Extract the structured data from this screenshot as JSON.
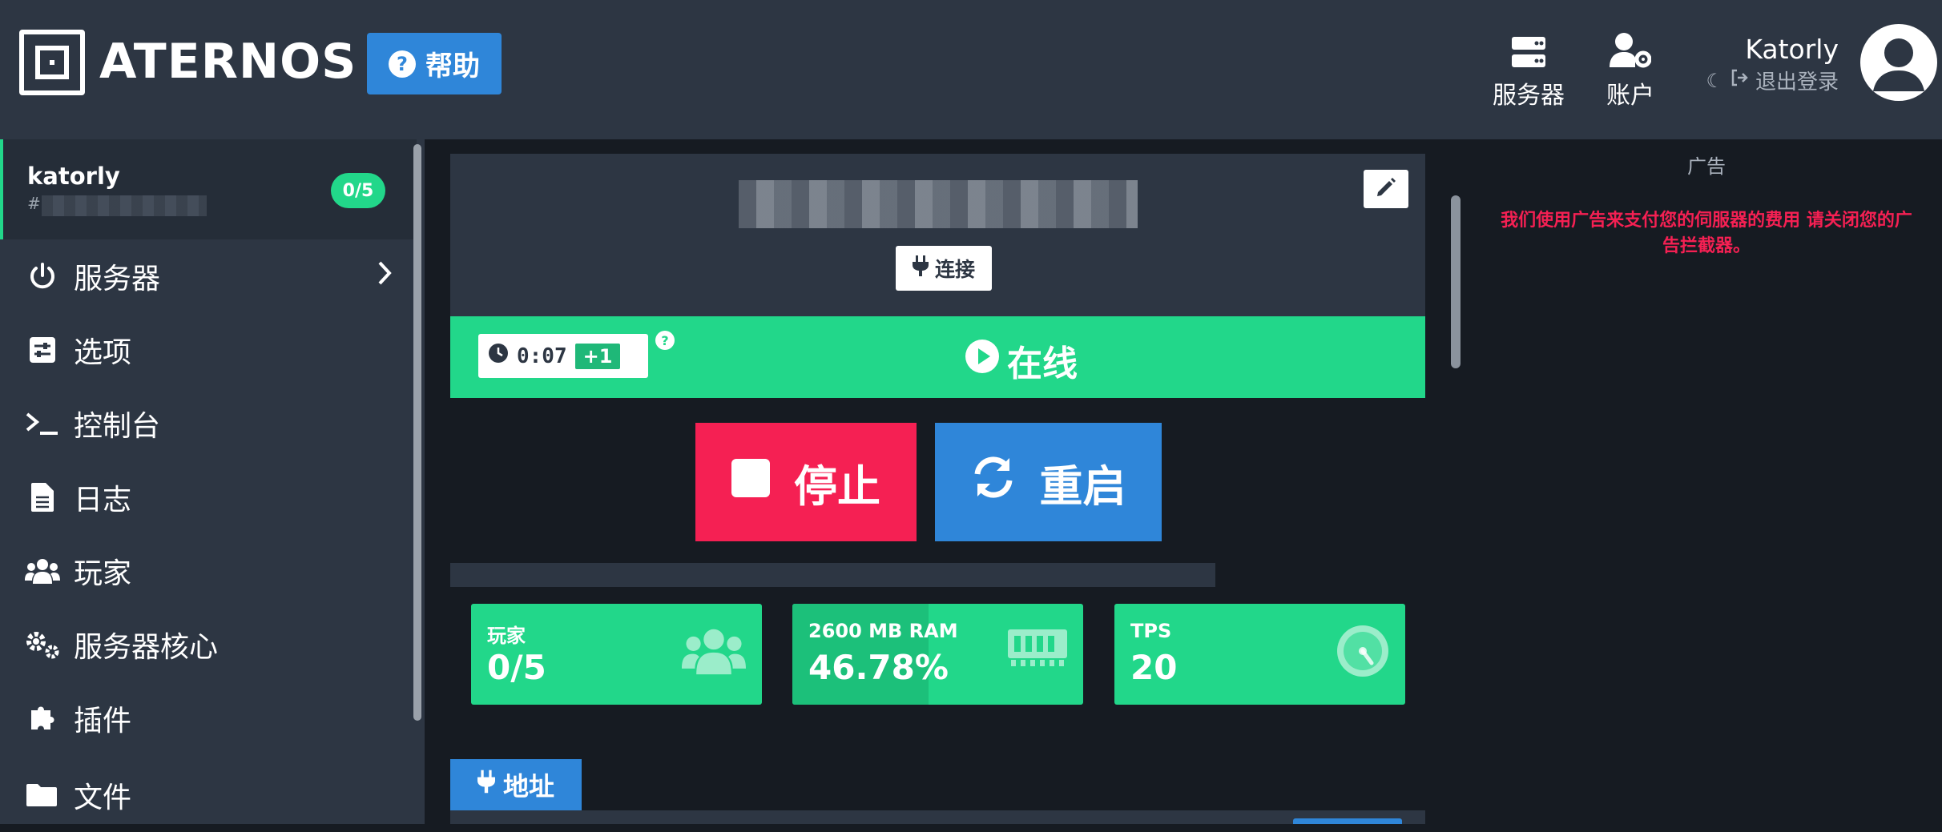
{
  "header": {
    "logo_text": "ATERNOS",
    "help_label": "帮助",
    "help_icon_glyph": "?",
    "nav": [
      {
        "label": "服务器",
        "icon": "server-icon"
      },
      {
        "label": "账户",
        "icon": "user-gear-icon"
      }
    ],
    "user_name": "Katorly",
    "logout_label": "退出登录"
  },
  "sidebar": {
    "server": {
      "name": "katorly",
      "id_prefix": "#",
      "players_badge": "0/5"
    },
    "items": [
      {
        "label": "服务器",
        "icon": "power-icon"
      },
      {
        "label": "选项",
        "icon": "sliders-icon"
      },
      {
        "label": "控制台",
        "icon": "terminal-icon"
      },
      {
        "label": "日志",
        "icon": "file-icon"
      },
      {
        "label": "玩家",
        "icon": "users-icon"
      },
      {
        "label": "服务器核心",
        "icon": "cogs-icon"
      },
      {
        "label": "插件",
        "icon": "puzzle-icon"
      },
      {
        "label": "文件",
        "icon": "folder-icon"
      }
    ]
  },
  "server_panel": {
    "connect_label": "连接",
    "timer": "0:07",
    "extend_label": "+1",
    "help_glyph": "?",
    "status_label": "在线",
    "status_color": "#22d78a"
  },
  "actions": {
    "stop_label": "停止",
    "restart_label": "重启",
    "stop_color": "#f52053",
    "restart_color": "#2f86d9"
  },
  "stats": [
    {
      "label": "玩家",
      "value": "0/5",
      "icon": "users-icon"
    },
    {
      "label": "2600 MB RAM",
      "value": "46.78%",
      "icon": "memory-icon",
      "fill_fraction": 0.4678
    },
    {
      "label": "TPS",
      "value": "20",
      "icon": "gauge-icon"
    }
  ],
  "address_tab_label": "地址",
  "ad": {
    "label": "广告",
    "notice": "我们使用广告来支付您的伺服器的费用 请关闭您的广告拦截器。"
  }
}
